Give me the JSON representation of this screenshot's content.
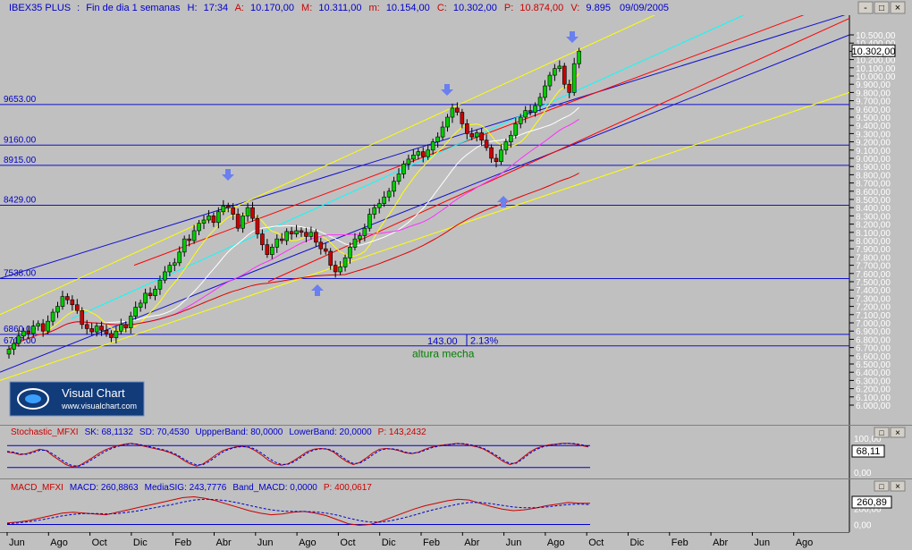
{
  "header": {
    "symbol": "IBEX35 PLUS",
    "period": "Fin de dia 1 semanas",
    "hour_label": "H:",
    "time": "17:34",
    "open_label": "A:",
    "open": "10.170,00",
    "high_label": "M:",
    "high": "10.311,00",
    "low_label": "m:",
    "low": "10.154,00",
    "close_label": "C:",
    "close": "10.302,00",
    "p_label": "P:",
    "p_value": "10.874,00",
    "v_label": "V:",
    "v_value": "9.895",
    "date": "09/09/2005"
  },
  "window_buttons": [
    "-",
    "□",
    "×"
  ],
  "logo": {
    "name": "Visual Chart",
    "url": "www.visualchart.com"
  },
  "colors": {
    "background": "#c0c0c0",
    "candle_up": "#00cc00",
    "candle_down": "#cc0000",
    "channel_blue": "#1010d0",
    "channel_yellow": "#ffff00",
    "trend_red": "#ff0000",
    "mavg_red": "#e00000",
    "mavg_magenta": "#ff30ff",
    "mavg_white": "#ffffff",
    "cyan": "#00ffff",
    "arrow": "#6a7ff0",
    "annotation_green": "#008000"
  },
  "chart_data": [
    {
      "type": "candlestick",
      "title": "IBEX35 PLUS",
      "x_tick_labels": [
        "Jun",
        "Ago",
        "Oct",
        "Dic",
        "Feb",
        "Abr",
        "Jun",
        "Ago",
        "Oct",
        "Dic",
        "Feb",
        "Abr",
        "Jun",
        "Ago",
        "Oct",
        "Dic",
        "Feb",
        "Abr",
        "Jun",
        "Ago"
      ],
      "y_tick_labels": [
        "10.500,00",
        "10.400,00",
        "10.300,00",
        "10.200,00",
        "10.100,00",
        "10.000,00",
        "9.900,00",
        "9.800,00",
        "9.700,00",
        "9.600,00",
        "9.500,00",
        "9.400,00",
        "9.300,00",
        "9.200,00",
        "9.100,00",
        "9.000,00",
        "8.900,00",
        "8.800,00",
        "8.700,00",
        "8.600,00",
        "8.500,00",
        "8.400,00",
        "8.300,00",
        "8.200,00",
        "8.100,00",
        "8.000,00",
        "7.900,00",
        "7.800,00",
        "7.700,00",
        "7.600,00",
        "7.500,00",
        "7.400,00",
        "7.300,00",
        "7.200,00",
        "7.100,00",
        "7.000,00",
        "6.900,00",
        "6.800,00",
        "6.700,00",
        "6.600,00",
        "6.500,00",
        "6.400,00",
        "6.300,00",
        "6.200,00",
        "6.100,00",
        "6.000,00"
      ],
      "ylim": [
        5800,
        10650
      ],
      "last_price_label": "10.302,00",
      "last_price": 10302,
      "horizontal_levels": [
        {
          "value": 9653,
          "label": "9653.00"
        },
        {
          "value": 9160,
          "label": "9160.00"
        },
        {
          "value": 8915,
          "label": "8915.00"
        },
        {
          "value": 8429,
          "label": "8429.00"
        },
        {
          "value": 7538,
          "label": "7538.00"
        },
        {
          "value": 6860,
          "label": "6860.00"
        },
        {
          "value": 6720,
          "label": "6717.00"
        }
      ],
      "annotations": [
        {
          "text": "143.00",
          "x": "Mar 05",
          "y": 6740
        },
        {
          "text": "2.13%",
          "x": "Abr 05",
          "y": 6790
        },
        {
          "text": "altura mecha",
          "x": "Mar 05",
          "y": 6580
        }
      ],
      "closes": [
        6680,
        6750,
        6840,
        6900,
        6870,
        6960,
        6990,
        6900,
        7020,
        7130,
        7200,
        7320,
        7280,
        7220,
        7150,
        6980,
        6930,
        6890,
        6960,
        6910,
        6870,
        6820,
        6900,
        6980,
        6940,
        7080,
        7190,
        7240,
        7360,
        7330,
        7410,
        7520,
        7620,
        7700,
        7730,
        7860,
        8020,
        8000,
        8120,
        8210,
        8250,
        8300,
        8220,
        8350,
        8420,
        8400,
        8320,
        8150,
        8300,
        8400,
        8270,
        8080,
        7950,
        7830,
        7920,
        8020,
        8000,
        8110,
        8080,
        8120,
        8100,
        8050,
        8100,
        7980,
        7900,
        7870,
        7700,
        7620,
        7680,
        7790,
        7920,
        8020,
        8060,
        8150,
        8320,
        8400,
        8450,
        8530,
        8600,
        8720,
        8810,
        8930,
        8990,
        9040,
        9080,
        9020,
        9100,
        9200,
        9260,
        9380,
        9500,
        9610,
        9560,
        9420,
        9300,
        9260,
        9310,
        9220,
        9130,
        9000,
        8960,
        9100,
        9200,
        9280,
        9420,
        9500,
        9580,
        9560,
        9640,
        9740,
        9880,
        10010,
        10090,
        10120,
        9900,
        9800,
        10150,
        10302
      ]
    },
    {
      "type": "line",
      "title": "Stochastic_MFXI",
      "header": [
        {
          "label": "Stochastic_MFXI",
          "color": "#cc0000"
        },
        {
          "label": "SK: 68,1132",
          "color": "#0000cc"
        },
        {
          "label": "SD: 70,4530",
          "color": "#0000cc"
        },
        {
          "label": "UppperBand: 80,0000",
          "color": "#0000cc"
        },
        {
          "label": "LowerBand: 20,0000",
          "color": "#0000cc"
        },
        {
          "label": "P: 143,2432",
          "color": "#cc0000"
        }
      ],
      "series": [
        {
          "name": "SK",
          "values": [
            62,
            60,
            55,
            58,
            64,
            70,
            66,
            52,
            40,
            28,
            22,
            25,
            35,
            46,
            58,
            68,
            75,
            80,
            84,
            86,
            83,
            78,
            74,
            70,
            66,
            60,
            52,
            40,
            30,
            24,
            30,
            42,
            55,
            66,
            72,
            76,
            78,
            75,
            66,
            54,
            40,
            30,
            26,
            30,
            40,
            52,
            64,
            70,
            72,
            70,
            62,
            48,
            36,
            28,
            34,
            46,
            60,
            70,
            72,
            70,
            66,
            60,
            58,
            62,
            70,
            76,
            80,
            82,
            84,
            86,
            84,
            80,
            76,
            70,
            60,
            48,
            36,
            28,
            34,
            48,
            62,
            72,
            78,
            82,
            84,
            86,
            86,
            84,
            80,
            76
          ]
        },
        {
          "name": "SD",
          "values": [
            64,
            62,
            57,
            56,
            61,
            67,
            67,
            57,
            45,
            33,
            25,
            24,
            31,
            42,
            53,
            64,
            72,
            78,
            82,
            85,
            84,
            80,
            76,
            72,
            68,
            63,
            55,
            44,
            34,
            27,
            28,
            37,
            50,
            62,
            70,
            75,
            77,
            76,
            70,
            59,
            46,
            35,
            28,
            29,
            36,
            48,
            60,
            68,
            71,
            71,
            65,
            53,
            40,
            31,
            32,
            42,
            55,
            66,
            71,
            71,
            68,
            62,
            59,
            61,
            67,
            74,
            78,
            81,
            83,
            85,
            85,
            82,
            78,
            72,
            63,
            52,
            40,
            31,
            32,
            44,
            58,
            69,
            76,
            80,
            83,
            85,
            86,
            85,
            82,
            78
          ]
        }
      ],
      "bands": [
        80,
        20
      ],
      "ylim": [
        0,
        100
      ],
      "y_tick_labels": [
        "100,00",
        "0,00"
      ],
      "last_value_label": "68,11"
    },
    {
      "type": "line",
      "title": "MACD_MFXI",
      "header": [
        {
          "label": "MACD_MFXI",
          "color": "#cc0000"
        },
        {
          "label": "MACD: 260,8863",
          "color": "#0000cc"
        },
        {
          "label": "MediaSIG: 243,7776",
          "color": "#0000cc"
        },
        {
          "label": "Band_MACD: 0,0000",
          "color": "#0000cc"
        },
        {
          "label": "P: 400,0617",
          "color": "#cc0000"
        }
      ],
      "series": [
        {
          "name": "MACD",
          "values": [
            20,
            30,
            50,
            80,
            110,
            140,
            150,
            140,
            130,
            120,
            150,
            180,
            210,
            240,
            270,
            300,
            330,
            340,
            320,
            290,
            250,
            210,
            170,
            140,
            120,
            130,
            150,
            160,
            140,
            110,
            60,
            10,
            -10,
            0,
            40,
            90,
            140,
            190,
            230,
            260,
            290,
            310,
            300,
            260,
            220,
            190,
            170,
            180,
            200,
            230,
            250,
            270,
            260,
            261
          ]
        },
        {
          "name": "MediaSIG",
          "values": [
            10,
            20,
            35,
            55,
            80,
            105,
            125,
            135,
            135,
            130,
            135,
            150,
            170,
            195,
            220,
            245,
            275,
            300,
            310,
            305,
            290,
            265,
            235,
            205,
            180,
            165,
            160,
            160,
            155,
            140,
            115,
            80,
            50,
            30,
            30,
            50,
            80,
            115,
            155,
            190,
            220,
            250,
            270,
            270,
            255,
            235,
            215,
            205,
            205,
            215,
            230,
            245,
            250,
            244
          ]
        }
      ],
      "zero_line": 0,
      "ylim": [
        -60,
        400
      ],
      "y_tick_labels": [
        "200,00",
        "0,00"
      ],
      "last_value_label": "260,89"
    }
  ]
}
